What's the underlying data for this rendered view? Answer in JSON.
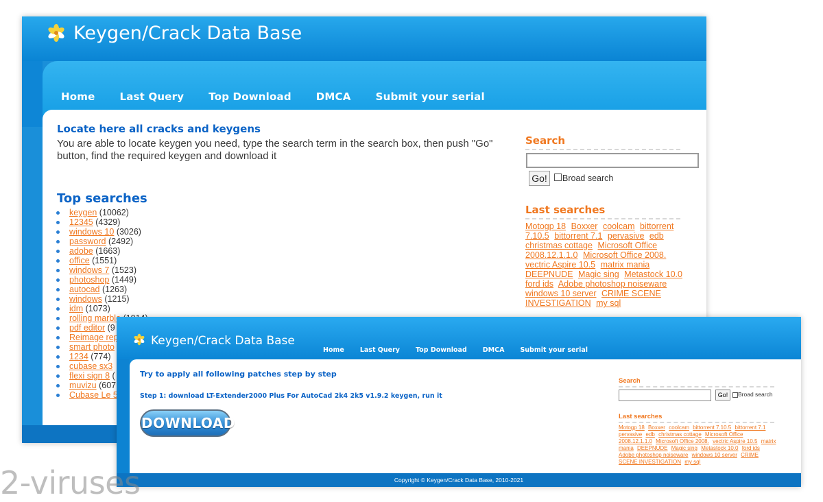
{
  "site": {
    "title": "Keygen/Crack Data Base",
    "nav": [
      "Home",
      "Last Query",
      "Top Download",
      "DMCA",
      "Submit your serial"
    ]
  },
  "back_window": {
    "locate_heading": "Locate here all cracks and keygens",
    "intro_text": "You are able to locate keygen you need, type the search term in the search box, then push \"Go\" button, find the required keygen and download it",
    "top_searches_heading": "Top searches",
    "top_searches": [
      {
        "term": "keygen",
        "count": "(10062)"
      },
      {
        "term": "12345",
        "count": "(4329)"
      },
      {
        "term": "windows 10",
        "count": "(3026)"
      },
      {
        "term": "password",
        "count": "(2492)"
      },
      {
        "term": "adobe",
        "count": "(1663)"
      },
      {
        "term": "office",
        "count": "(1551)"
      },
      {
        "term": "windows 7",
        "count": "(1523)"
      },
      {
        "term": "photoshop",
        "count": "(1449)"
      },
      {
        "term": "autocad",
        "count": "(1263)"
      },
      {
        "term": "windows",
        "count": "(1215)"
      },
      {
        "term": "idm",
        "count": "(1073)"
      },
      {
        "term": "rolling marble",
        "count": "(1014)"
      },
      {
        "term": "pdf editor",
        "count": "(9"
      },
      {
        "term": "Reimage rep",
        "count": ""
      },
      {
        "term": "smart photo",
        "count": ""
      },
      {
        "term": "1234",
        "count": "(774)"
      },
      {
        "term": "cubase sx3",
        "count": ""
      },
      {
        "term": "flexi sign 8",
        "count": "("
      },
      {
        "term": "muvizu",
        "count": "(607"
      },
      {
        "term": "Cubase Le 5",
        "count": ""
      }
    ],
    "search_heading": "Search",
    "search_input_value": "",
    "go_label": "Go!",
    "broad_search_label": "Broad search",
    "last_searches_heading": "Last searches",
    "last_searches": [
      "Motogp 18",
      "Boxxer",
      "coolcam",
      "bittorrent 7.10.5",
      "bittorrent 7.1",
      "pervasive",
      "edb",
      "christmas cottage",
      "Microsoft Office 2008.12.1.1.0",
      "Microsoft Office 2008.",
      "vectric Aspire 10.5",
      "matrix mania",
      "DEEPNUDE",
      "Magic sing",
      "Metastock 10.0",
      "ford ids",
      "Adobe photoshop noiseware",
      "windows 10 server",
      "CRIME SCENE INVESTIGATION",
      "my sql"
    ]
  },
  "front_window": {
    "try_heading": "Try to apply all following patches step by step",
    "step_text": "Step 1: download LT-Extender2000 Plus For AutoCad 2k4 2k5 v1.9.2 keygen, run it",
    "download_label": "DOWNLOAD",
    "search_heading": "Search",
    "search_input_value": "",
    "go_label": "Go!",
    "broad_search_label": "Broad search",
    "last_searches_heading": "Last searches",
    "last_searches": [
      "Motogp 18",
      "Boxxer",
      "coolcam",
      "bittorrent 7.10.5",
      "bittorrent 7.1",
      "pervasive",
      "edb",
      "christmas cottage",
      "Microsoft Office 2008.12.1.1.0",
      "Microsoft Office 2008.",
      "vectric Aspire 10.5",
      "matrix mania",
      "DEEPNUDE",
      "Magic sing",
      "Metastock 10.0",
      "ford ids",
      "Adobe photoshop noiseware",
      "windows 10 server",
      "CRIME SCENE INVESTIGATION",
      "my sql"
    ],
    "copyright": "Copyright © Keygen/Crack Data Base, 2010-2021"
  },
  "watermark": "2-viruses",
  "colors": {
    "header_blue": "#0a84d4",
    "heading_blue": "#0b63c6",
    "link_orange": "#f07820"
  },
  "icons": {
    "logo": "flower-icon",
    "list_bullet": "bullet-icon"
  }
}
